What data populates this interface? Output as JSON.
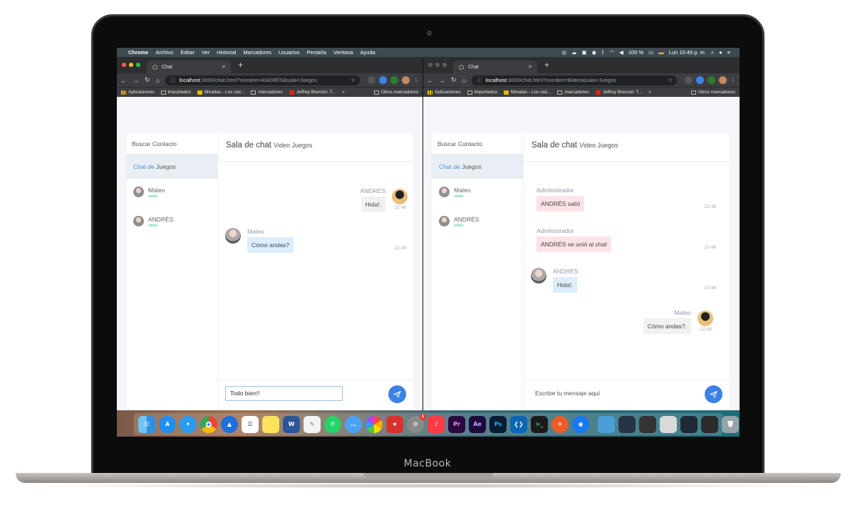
{
  "device": {
    "label": "MacBook"
  },
  "menubar": {
    "app": "Chrome",
    "items": [
      "Archivo",
      "Editar",
      "Ver",
      "Historial",
      "Marcadores",
      "Usuarios",
      "Pestaña",
      "Ventana",
      "Ayuda"
    ],
    "battery": "100 %",
    "clock": "Lun 10:49 p. m."
  },
  "left_window": {
    "tab_title": "Chat",
    "url_host": "localhost",
    "url_rest": ":3000/chat.html?nombre=ANDRÉS&sala=Juegos",
    "bookmarks": [
      "Aplicaciones",
      "Importados",
      "Miradas - Los sist...",
      "marcadores",
      "Jeffrey Brenzel: T...",
      "»",
      "Otros marcadores"
    ],
    "contacts_search": "Buscar Contacto",
    "room_prefix": "Chat de",
    "room_name": "Juegos",
    "contacts": [
      {
        "name": "Mateo",
        "status": "online"
      },
      {
        "name": "ANDRÉS",
        "status": "online"
      }
    ],
    "chat_title": "Sala de chat",
    "chat_subtitle": "Video Juegos",
    "messages": [
      {
        "from": "ANDRÉS",
        "text": "Hola!.",
        "time": "22:48"
      },
      {
        "from": "Mateo",
        "text": "Cómo andas?",
        "time": "22:48"
      }
    ],
    "input_value": "Todo bien!!"
  },
  "right_window": {
    "tab_title": "Chat",
    "url_host": "localhost",
    "url_rest": ":3000/chat.html?nombre=Mateo&sala=Juegos",
    "bookmarks": [
      "Aplicaciones",
      "Importados",
      "Miradas - Los sist...",
      "marcadores",
      "Jeffrey Brenzel: T...",
      "»",
      "Otros marcadores"
    ],
    "contacts_search": "Buscar Contacto",
    "room_prefix": "Chat de",
    "room_name": "Juegos",
    "contacts": [
      {
        "name": "Mateo",
        "status": "online"
      },
      {
        "name": "ANDRÉS",
        "status": "online"
      }
    ],
    "chat_title": "Sala de chat",
    "chat_subtitle": "Video Juegos",
    "messages": [
      {
        "from": "Administrador",
        "text": "ANDRÉS salió",
        "time": "22:48"
      },
      {
        "from": "Administrador",
        "text": "ANDRÉS se unió al chat",
        "time": "22:48"
      },
      {
        "from": "ANDRÉS",
        "text": "Hola!.",
        "time": "22:48"
      },
      {
        "from": "Mateo",
        "text": "Cómo andas?.",
        "time": "22:48"
      }
    ],
    "input_placeholder": "Escribe tu mensaje aquí"
  },
  "dock": {
    "apps": [
      "finder-icon",
      "app-store-icon",
      "safari-icon",
      "chrome-icon",
      "launchpad-icon",
      "notes-icon",
      "stickies-icon",
      "word-icon",
      "textedit-icon",
      "whatsapp-icon",
      "messages-icon",
      "photos-icon",
      "bookmark-app-icon",
      "system-preferences-icon",
      "music-icon",
      "premiere-icon",
      "after-effects-icon",
      "photoshop-icon",
      "vscode-icon",
      "terminal-icon",
      "postman-icon",
      "maps-pin-icon"
    ],
    "labels": {
      "premiere": "Pr",
      "after_effects": "Ae",
      "photoshop": "Ps"
    },
    "badge": "1"
  },
  "colors": {
    "accent": "#3b82e6",
    "online": "#2ec27e",
    "admin_bubble": "#fbe3e6",
    "self_bubble": "#dceefc"
  }
}
